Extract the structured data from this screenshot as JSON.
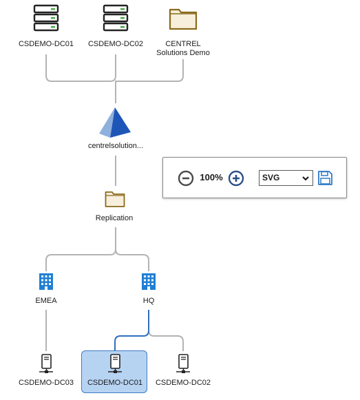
{
  "diagram": {
    "top_nodes": [
      {
        "label": "CSDEMO-DC01",
        "icon": "server-rack-icon"
      },
      {
        "label": "CSDEMO-DC02",
        "icon": "server-rack-icon"
      },
      {
        "label_line1": "CENTREL",
        "label_line2": "Solutions Demo",
        "icon": "folder-icon"
      }
    ],
    "domain_node": {
      "label": "centrelsolution...",
      "icon": "pyramid-domain-icon"
    },
    "container_node": {
      "label": "Replication",
      "icon": "folder-icon"
    },
    "sites": [
      {
        "label": "EMEA",
        "icon": "building-icon"
      },
      {
        "label": "HQ",
        "icon": "building-icon"
      }
    ],
    "bottom_nodes": [
      {
        "label": "CSDEMO-DC03",
        "icon": "computer-network-icon",
        "selected": false
      },
      {
        "label": "CSDEMO-DC01",
        "icon": "computer-network-icon",
        "selected": true
      },
      {
        "label": "CSDEMO-DC02",
        "icon": "computer-network-icon",
        "selected": false
      }
    ],
    "colors": {
      "connector": "#b3b3b3",
      "connector_selected": "#2d6fbf",
      "selection_fill": "#b7d3f2",
      "selection_border": "#3d7bc4",
      "folder_stroke": "#8a6a1a",
      "folder_fill": "#f7efdc",
      "building": "#1f7fd4"
    }
  },
  "toolbar": {
    "zoom_out_icon": "minus-circle-icon",
    "zoom_level": "100%",
    "zoom_in_icon": "plus-circle-icon",
    "export_format": "SVG",
    "save_icon": "floppy-disk-icon"
  }
}
